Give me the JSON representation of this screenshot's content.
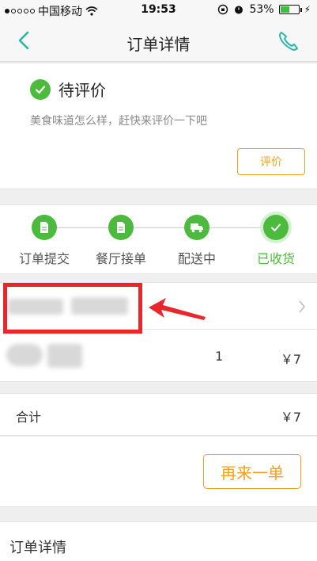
{
  "status_bar": {
    "carrier": "中国移动",
    "time": "19:53",
    "battery_pct": "53%",
    "battery_level": 0.53
  },
  "nav": {
    "title": "订单详情",
    "back_icon": "chevron-left-icon",
    "phone_icon": "phone-icon"
  },
  "order_status": {
    "title": "待评价",
    "subtitle": "美食味道怎么样，赶快来评价一下吧",
    "rate_button": "评价"
  },
  "progress": {
    "steps": [
      {
        "label": "订单提交",
        "icon": "document-icon"
      },
      {
        "label": "餐厅接单",
        "icon": "document-icon"
      },
      {
        "label": "配送中",
        "icon": "truck-icon"
      },
      {
        "label": "已收货",
        "icon": "check-icon"
      }
    ],
    "current_step": 4
  },
  "shop": {
    "name_obscured": true
  },
  "item": {
    "qty": "1",
    "price": "￥7"
  },
  "total": {
    "label": "合计",
    "value": "￥7"
  },
  "reorder_button": "再来一单",
  "details": {
    "title": "订单详情"
  },
  "colors": {
    "accent_green": "#4cba3c",
    "accent_orange": "#f0a020",
    "nav_teal": "#2bb5a8",
    "annotation_red": "#e8262b"
  }
}
